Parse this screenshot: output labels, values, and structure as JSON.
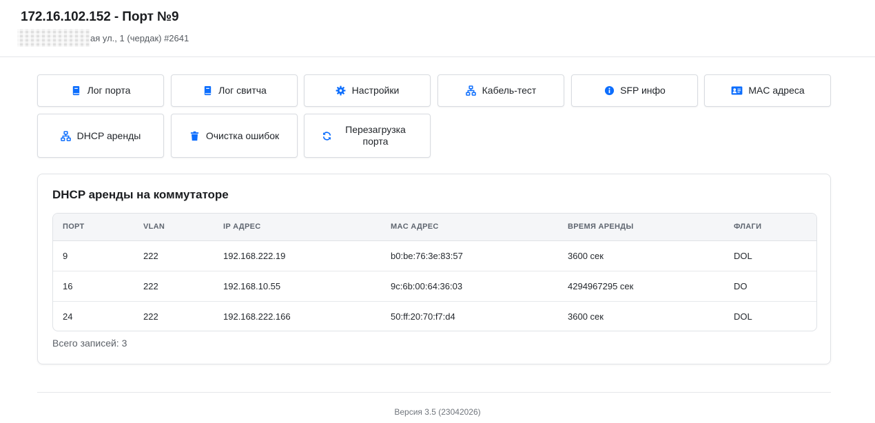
{
  "header": {
    "title": "172.16.102.152 - Порт №9",
    "address": "ая ул., 1 (чердак) #2641"
  },
  "buttons": [
    {
      "label": "Лог порта",
      "icon": "book-icon"
    },
    {
      "label": "Лог свитча",
      "icon": "book-icon"
    },
    {
      "label": "Настройки",
      "icon": "gear-icon"
    },
    {
      "label": "Кабель-тест",
      "icon": "network-icon"
    },
    {
      "label": "SFP инфо",
      "icon": "info-icon"
    },
    {
      "label": "MAC адреса",
      "icon": "id-card-icon"
    },
    {
      "label": "DHCP аренды",
      "icon": "network-icon"
    },
    {
      "label": "Очистка ошибок",
      "icon": "trash-icon"
    },
    {
      "label": "Перезагрузка порта",
      "icon": "refresh-icon"
    }
  ],
  "accent_color": "#0d6efd",
  "card": {
    "title": "DHCP аренды на коммутаторе",
    "columns": [
      "ПОРТ",
      "VLAN",
      "IP АДРЕС",
      "MAC АДРЕС",
      "ВРЕМЯ АРЕНДЫ",
      "ФЛАГИ"
    ],
    "rows": [
      [
        "9",
        "222",
        "192.168.222.19",
        "b0:be:76:3e:83:57",
        "3600 сек",
        "DOL"
      ],
      [
        "16",
        "222",
        "192.168.10.55",
        "9c:6b:00:64:36:03",
        "4294967295 сек",
        "DO"
      ],
      [
        "24",
        "222",
        "192.168.222.166",
        "50:ff:20:70:f7:d4",
        "3600 сек",
        "DOL"
      ]
    ],
    "total": "Всего записей: 3"
  },
  "footer": {
    "version": "Версия 3.5 (23042026)"
  }
}
